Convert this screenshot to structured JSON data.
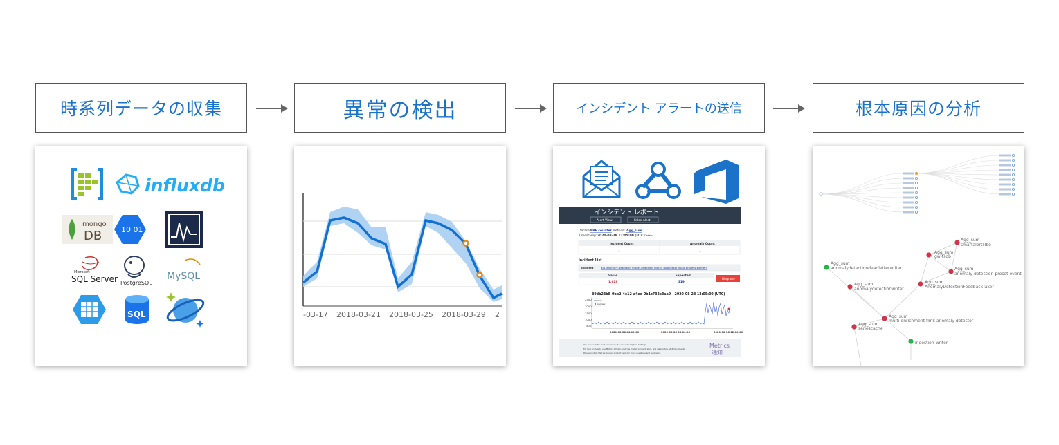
{
  "steps": [
    {
      "title": "時系列データの収集"
    },
    {
      "title": "異常の検出"
    },
    {
      "title": "インシデント アラートの送信"
    },
    {
      "title": "根本原因の分析"
    }
  ],
  "sources": {
    "influx": "influxdb",
    "mongo_top": "mongo",
    "mongo_bottom": "DB",
    "sqlserver_small": "Microsoft",
    "sqlserver": "SQL Server",
    "postgres": "PostgreSQL",
    "mysql": "MySQL",
    "bigdata": "10 01",
    "sql": "SQL"
  },
  "detection_chart": {
    "x_ticks": [
      "-03-17",
      "2018-03-21",
      "2018-03-25",
      "2018-03-29",
      "2"
    ]
  },
  "alert_report": {
    "header_title": "インシデント レポート",
    "btn_alert_view": "Alert View",
    "btn_false_alert": "False Alert",
    "dataset_label": "Dataset:",
    "dataset_value": "PPE counter",
    "metrics_label": "Metrics:",
    "metrics_value": "Agg_sum",
    "timestamp_label": "Timestamp:",
    "timestamp_value": "2020-08-28 12:05:00 (UTC)",
    "timestamp_suffix": "Details",
    "incident_count_label": "Incident Count",
    "incident_count_value": "1",
    "anomaly_count_label": "Anomaly Count",
    "anomaly_count_value": "1",
    "incident_list_title": "Incident List",
    "incident_label": "Incident",
    "incident_value": "acs_anomaly-detection model-selection_metric: processor input process element",
    "value_label": "Value",
    "value_value": "1,628",
    "expected_label": "Expected",
    "expected_value": "319",
    "diagnose_button": "Diagnose",
    "mini_chart_title": "89db23b8-0bb2-4e12-a4ee-0b1c732e3aa9 - 2020-08-28 12:05:00 (UTC)",
    "legend_value": "Value",
    "legend_anomaly": "Anomaly",
    "y_ticks": [
      "2500",
      "2000",
      "1500",
      "1000",
      "500"
    ],
    "x_ticks": [
      "2020-08-28 04:00:00",
      "2020-08-28 08:00:00",
      "2020-08-28 12:00:00"
    ],
    "footer_line1": "You received this alert as a result of a new subscription. Settings",
    "footer_line2": "For help on how to use Metrics Advisor, visit the model, incident, alert, and diagnostics. Visit Documents",
    "footer_line3": "Please contact Metrics Advisor product team for more questions and feedbacks.",
    "footer_logo_top": "Metrics",
    "footer_logo_bottom": "通知"
  },
  "root_cause": {
    "nodes": [
      {
        "prefix": "Agg_sum",
        "name": "smartalertlilbe"
      },
      {
        "prefix": "Agg_sum",
        "name": "gw-tsdb"
      },
      {
        "prefix": "Agg_sum",
        "name": "anomaly-detection-preset-event"
      },
      {
        "prefix": "Agg_sum",
        "name": "anomalydetectiondeadletterwriter"
      },
      {
        "prefix": "Agg_sum",
        "name": "AnomalyDetectionFeedbackTaker"
      },
      {
        "prefix": "Agg_sum",
        "name": "anomalydetectionwriter"
      },
      {
        "prefix": "Agg_sum",
        "name": "multi-enrichment-flink-anomaly-detector"
      },
      {
        "prefix": "Agg_sum",
        "name": "seriescache"
      },
      {
        "prefix": "Agg_sum",
        "name": "ingestion-writer"
      }
    ],
    "colors": {
      "red": "#d2344a",
      "green": "#27b24a",
      "tree": "#6a9fd8"
    }
  },
  "colors": {
    "accent": "#1a73c9",
    "line": "#1170d0",
    "band": "#a8cef2",
    "anomaly": "#e08a1e"
  }
}
